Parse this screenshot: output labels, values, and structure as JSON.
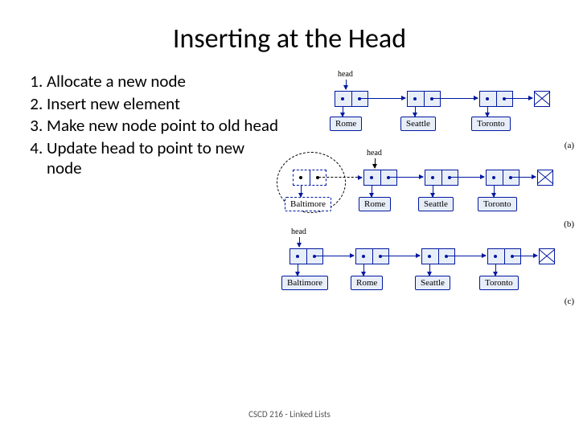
{
  "title": "Inserting at the Head",
  "steps": [
    "Allocate a new node",
    "Insert new element",
    "Make new node point to old head",
    "Update head to point to new node"
  ],
  "diagrams": {
    "a": {
      "head_label": "head",
      "nodes": [
        "Rome",
        "Seattle",
        "Toronto"
      ],
      "caption": "(a)"
    },
    "b": {
      "head_label": "head",
      "new_node": "Baltimore",
      "nodes": [
        "Rome",
        "Seattle",
        "Toronto"
      ],
      "caption": "(b)"
    },
    "c": {
      "head_label": "head",
      "nodes": [
        "Baltimore",
        "Rome",
        "Seattle",
        "Toronto"
      ],
      "caption": "(c)"
    }
  },
  "footer": "CSCD 216 - Linked Lists"
}
